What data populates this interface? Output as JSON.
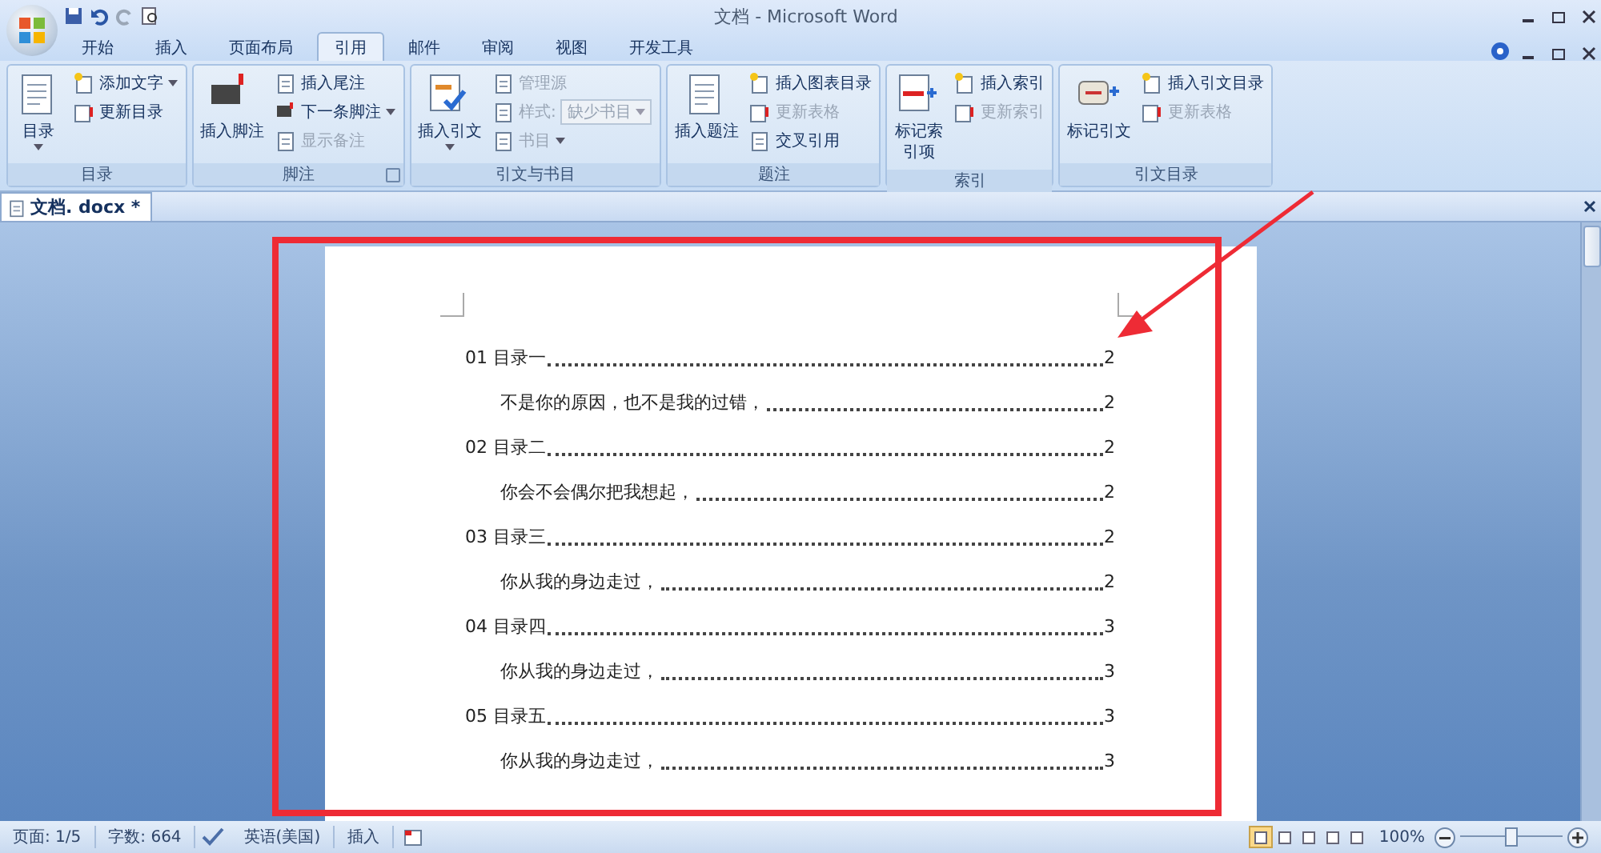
{
  "window": {
    "title": "文档 - Microsoft Word"
  },
  "ribbon_tabs": [
    {
      "label": "开始",
      "selected": false
    },
    {
      "label": "插入",
      "selected": false
    },
    {
      "label": "页面布局",
      "selected": false
    },
    {
      "label": "引用",
      "selected": true
    },
    {
      "label": "邮件",
      "selected": false
    },
    {
      "label": "审阅",
      "selected": false
    },
    {
      "label": "视图",
      "selected": false
    },
    {
      "label": "开发工具",
      "selected": false
    }
  ],
  "ribbon_groups": [
    {
      "label": "目录",
      "launcher": false,
      "large": {
        "label": "目录",
        "dropdown": true
      },
      "small": [
        {
          "label": "添加文字",
          "dropdown": true,
          "disabled": false
        },
        {
          "label": "更新目录",
          "dropdown": false,
          "disabled": false
        }
      ]
    },
    {
      "label": "脚注",
      "launcher": true,
      "large": {
        "label": "插入脚注",
        "dropdown": false
      },
      "small": [
        {
          "label": "插入尾注",
          "dropdown": false,
          "disabled": false
        },
        {
          "label": "下一条脚注",
          "dropdown": true,
          "disabled": false
        },
        {
          "label": "显示备注",
          "dropdown": false,
          "disabled": true
        }
      ]
    },
    {
      "label": "引文与书目",
      "launcher": false,
      "large": {
        "label": "插入引文",
        "dropdown": true
      },
      "small": [
        {
          "label": "管理源",
          "dropdown": false,
          "disabled": true
        },
        {
          "label": "样式:",
          "dropdown": false,
          "disabled": true,
          "value": "缺少书目"
        },
        {
          "label": "书目",
          "dropdown": true,
          "disabled": true
        }
      ]
    },
    {
      "label": "题注",
      "launcher": false,
      "large": {
        "label": "插入题注",
        "dropdown": false
      },
      "small": [
        {
          "label": "插入图表目录",
          "dropdown": false,
          "disabled": false
        },
        {
          "label": "更新表格",
          "dropdown": false,
          "disabled": true
        },
        {
          "label": "交叉引用",
          "dropdown": false,
          "disabled": false
        }
      ]
    },
    {
      "label": "索引",
      "launcher": false,
      "large": {
        "label": "标记索引项",
        "dropdown": false
      },
      "small": [
        {
          "label": "插入索引",
          "dropdown": false,
          "disabled": false
        },
        {
          "label": "更新索引",
          "dropdown": false,
          "disabled": true
        }
      ]
    },
    {
      "label": "引文目录",
      "launcher": false,
      "large": {
        "label": "标记引文",
        "dropdown": false
      },
      "small": [
        {
          "label": "插入引文目录",
          "dropdown": false,
          "disabled": false
        },
        {
          "label": "更新表格",
          "dropdown": false,
          "disabled": true
        }
      ]
    }
  ],
  "document_tab": {
    "label": "文档. docx *"
  },
  "toc": [
    {
      "title": "01 目录一",
      "page": "2",
      "children": [
        {
          "title": "不是你的原因，也不是我的过错，",
          "page": "2"
        }
      ]
    },
    {
      "title": "02 目录二",
      "page": "2",
      "children": [
        {
          "title": "你会不会偶尔把我想起，",
          "page": "2"
        }
      ]
    },
    {
      "title": "03 目录三",
      "page": "2",
      "children": [
        {
          "title": "你从我的身边走过，",
          "page": "2"
        }
      ]
    },
    {
      "title": "04 目录四",
      "page": "3",
      "children": [
        {
          "title": "你从我的身边走过，",
          "page": "3"
        }
      ]
    },
    {
      "title": "05 目录五",
      "page": "3",
      "children": [
        {
          "title": "你从我的身边走过，",
          "page": "3"
        }
      ]
    }
  ],
  "status_bar": {
    "page": "页面: 1/5",
    "words": "字数: 664",
    "language": "英语(美国)",
    "mode": "插入",
    "zoom": "100%",
    "zoom_slider": {
      "level": 0.5
    },
    "views": [
      {
        "selected": true
      },
      {
        "selected": false
      },
      {
        "selected": false
      },
      {
        "selected": false
      },
      {
        "selected": false
      }
    ]
  }
}
